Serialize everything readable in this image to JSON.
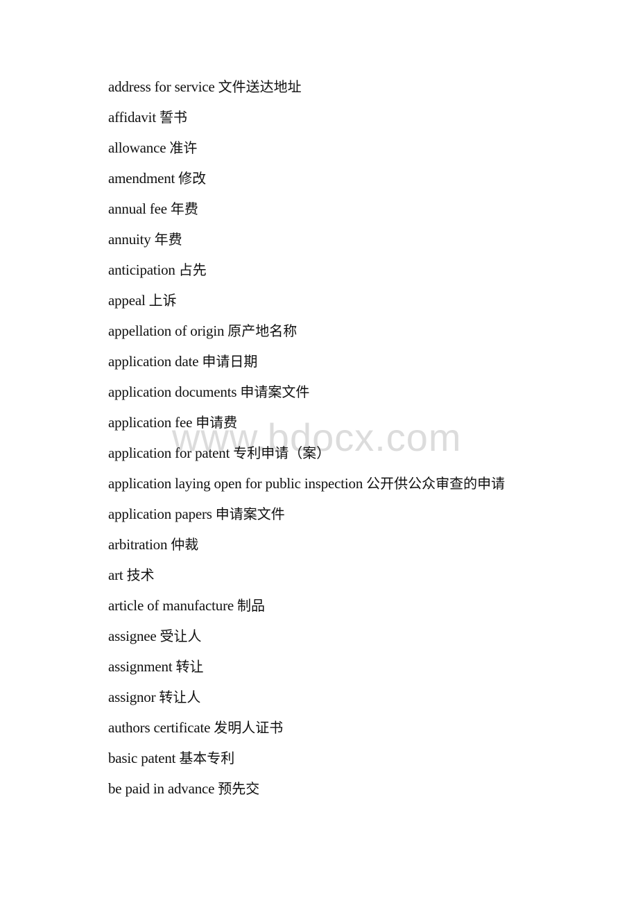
{
  "document": {
    "watermark": "www.bdocx.com",
    "entries": [
      {
        "term": "address for service",
        "translation": "文件送达地址"
      },
      {
        "term": "affidavit",
        "translation": "誓书"
      },
      {
        "term": "allowance",
        "translation": "准许"
      },
      {
        "term": "amendment",
        "translation": "修改"
      },
      {
        "term": "annual fee",
        "translation": "年费"
      },
      {
        "term": "annuity",
        "translation": "年费"
      },
      {
        "term": "anticipation",
        "translation": "占先"
      },
      {
        "term": "appeal",
        "translation": "上诉"
      },
      {
        "term": "appellation of origin",
        "translation": "原产地名称"
      },
      {
        "term": "application date",
        "translation": "申请日期"
      },
      {
        "term": "application documents",
        "translation": "申请案文件"
      },
      {
        "term": "application fee",
        "translation": "申请费"
      },
      {
        "term": "application for patent",
        "translation": "专利申请（案）"
      },
      {
        "term": "application laying open for public inspection",
        "translation": "公开供公众审查的申请"
      },
      {
        "term": "application papers",
        "translation": "申请案文件"
      },
      {
        "term": "arbitration",
        "translation": "仲裁"
      },
      {
        "term": "art",
        "translation": "技术"
      },
      {
        "term": "article of manufacture",
        "translation": "制品"
      },
      {
        "term": "assignee",
        "translation": "受让人"
      },
      {
        "term": "assignment",
        "translation": "转让"
      },
      {
        "term": "assignor",
        "translation": "转让人"
      },
      {
        "term": "authors certificate",
        "translation": "发明人证书"
      },
      {
        "term": "basic patent",
        "translation": "基本专利"
      },
      {
        "term": "be paid in advance",
        "translation": "预先交"
      }
    ]
  }
}
